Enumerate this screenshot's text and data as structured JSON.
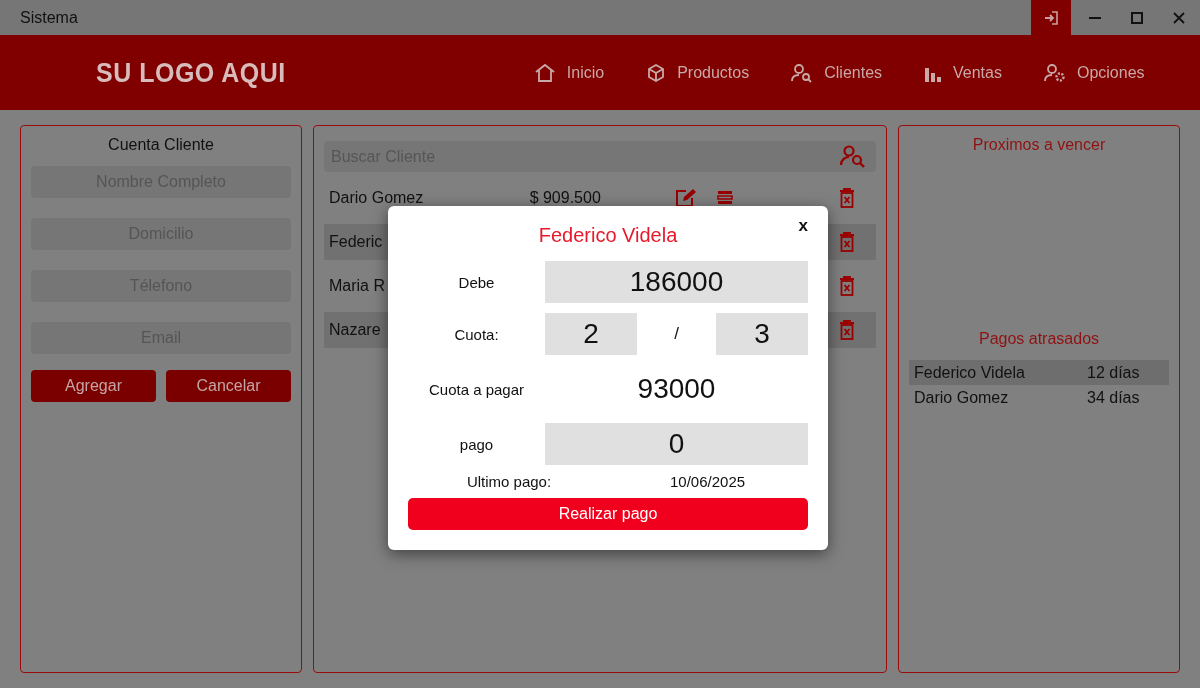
{
  "window": {
    "title": "Sistema"
  },
  "header": {
    "logo": "SU LOGO AQUI",
    "nav": [
      {
        "label": "Inicio"
      },
      {
        "label": "Productos"
      },
      {
        "label": "Clientes"
      },
      {
        "label": "Ventas"
      },
      {
        "label": "Opciones"
      }
    ]
  },
  "account_form": {
    "title": "Cuenta Cliente",
    "fields": [
      {
        "placeholder": "Nombre Completo"
      },
      {
        "placeholder": "Domicilio"
      },
      {
        "placeholder": "Télefono"
      },
      {
        "placeholder": "Email"
      }
    ],
    "buttons": [
      "Agregar",
      "Cancelar"
    ]
  },
  "clients": {
    "search": {
      "placeholder": "Buscar Cliente"
    },
    "rows": [
      {
        "kind": "full",
        "name": "Dario Gomez",
        "amount": "$ 909.500"
      },
      {
        "kind": "covered",
        "name": "Federic"
      },
      {
        "kind": "covered",
        "name": "Maria R"
      },
      {
        "kind": "covered",
        "name": "Nazare"
      }
    ]
  },
  "side": {
    "upcoming_title": "Proximos a vencer",
    "overdue_title": "Pagos atrasados",
    "overdue": [
      {
        "name": "Federico Videla",
        "days": "12 días"
      },
      {
        "name": "Dario Gomez",
        "days": "34 días"
      }
    ]
  },
  "payment_dialog": {
    "title": "Federico Videla",
    "close": "x",
    "debe_label": "Debe",
    "debe": "186000",
    "cuota_label": "Cuota:",
    "cuota_current": "2",
    "separator": "/",
    "cuota_total": "3",
    "cuota_pagar_label": "Cuota a pagar",
    "cuota_pagar": "93000",
    "pago_label": "pago",
    "pago": "0",
    "ultimo_label": "Ultimo pago:",
    "ultimo": "10/06/2025",
    "button": "Realizar pago"
  }
}
